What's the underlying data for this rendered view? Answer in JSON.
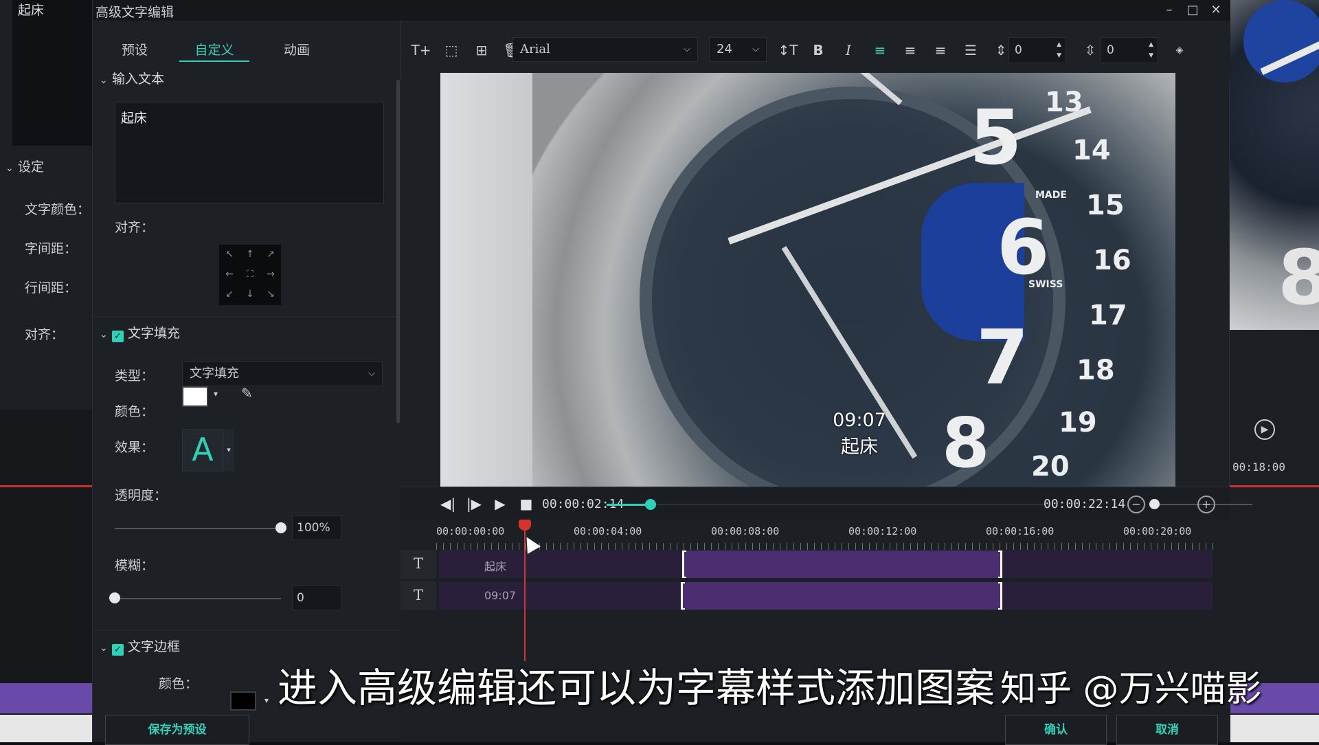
{
  "background_left": {
    "clip_name": "起床",
    "settings_head": "设定",
    "props": [
      "文字颜色：",
      "字间距：",
      "行间距：",
      "对齐："
    ]
  },
  "background_right": {
    "timecode": "00:18:00"
  },
  "dialog": {
    "title": "高级文字编辑",
    "window_buttons": {
      "minimize": "–",
      "maximize": "□",
      "close": "✕"
    }
  },
  "tabs": [
    "预设",
    "自定义",
    "动画"
  ],
  "active_tab": "自定义",
  "sections": {
    "input_text": {
      "title": "输入文本",
      "value": "起床",
      "align_label": "对齐："
    },
    "text_fill": {
      "title": "文字填充",
      "checked": true,
      "type_label": "类型：",
      "type_value": "文字填充",
      "color_label": "颜色：",
      "color": "#ffffff",
      "effect_label": "效果：",
      "effect_glyph": "A",
      "opacity_label": "透明度：",
      "opacity_value": "100%",
      "opacity_fraction": 1.0,
      "blur_label": "模糊：",
      "blur_value": "0",
      "blur_fraction": 0.0
    },
    "text_border": {
      "title": "文字边框",
      "checked": true,
      "color_label": "颜色：",
      "color": "#000000"
    }
  },
  "buttons": {
    "save_preset": "保存为预设",
    "confirm": "确认",
    "cancel": "取消"
  },
  "toolbar": {
    "font": "Arial",
    "size": "24",
    "spacing_value": "0",
    "line_spacing_value": "0",
    "icons": [
      "add-text-icon",
      "crop-box-icon",
      "add-image-icon",
      "delete-icon",
      "text-size-icon",
      "bold-icon",
      "italic-icon",
      "align-left-icon",
      "align-center-icon",
      "align-right-icon",
      "justify-icon",
      "spacing-icon",
      "line-spacing-icon",
      "diamond-icon"
    ]
  },
  "preview": {
    "caption_time": "09:07",
    "caption_text": "起床",
    "dial_numbers": [
      "13",
      "14",
      "15",
      "16",
      "17",
      "18",
      "19",
      "20",
      "5",
      "6",
      "7",
      "8"
    ],
    "dial_labels": [
      "MADE",
      "SWISS"
    ]
  },
  "playback": {
    "current_time": "00:00:02:14",
    "total_time": "00:00:22:14",
    "progress_fraction": 0.1
  },
  "timeline": {
    "ruler": [
      "00:00:00:00",
      "00:00:04:00",
      "00:00:08:00",
      "00:00:12:00",
      "00:00:16:00",
      "00:00:20:00"
    ],
    "tracks": [
      {
        "icon": "T",
        "label": "起床"
      },
      {
        "icon": "T",
        "label": "09:07"
      }
    ]
  },
  "overlay": {
    "subtitle": "进入高级编辑还可以为字幕样式添加图案",
    "watermark": "知乎 @万兴喵影"
  }
}
